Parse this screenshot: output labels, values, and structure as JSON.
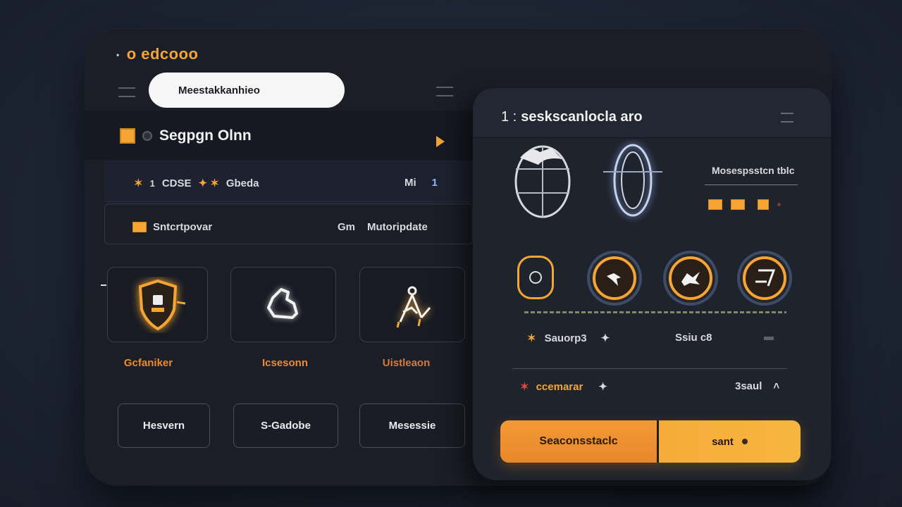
{
  "app": {
    "brand": "o edcooo",
    "brand_prefix": "•"
  },
  "search": {
    "value": "Meestakkanhieo"
  },
  "section": {
    "title": "Segpgn Olnn"
  },
  "rows": [
    {
      "bullet": "1",
      "label1": "CDSE",
      "label2": "Gbeda",
      "right1": "Mi",
      "right2": "1"
    },
    {
      "label1": "Sntcrtpovar",
      "right1": "Gm",
      "right2": "Mutoripdate"
    }
  ],
  "tiles": [
    {
      "label": "Gcfaniker",
      "icon": "shield-icon"
    },
    {
      "label": "Icsesonn",
      "icon": "puzzle-icon"
    },
    {
      "label": "Uistleaon",
      "icon": "pen-tool-icon"
    }
  ],
  "buttons": [
    "Hesvern",
    "S-Gadobe",
    "Mesessie"
  ],
  "right_panel": {
    "title_num": "1 :",
    "title": "seskscanlocla aro",
    "side_label": "Mosespsstcn tblc",
    "rows": [
      {
        "label": "Sauorp3",
        "value": "Ssiu c8"
      },
      {
        "label": "ccemarar",
        "value": "3saul"
      }
    ],
    "primary_button": "Seaconsstaclc",
    "secondary_button": "sant"
  },
  "colors": {
    "accent": "#f5a534",
    "bg": "#1e2534",
    "panel": "#1b1e27"
  }
}
